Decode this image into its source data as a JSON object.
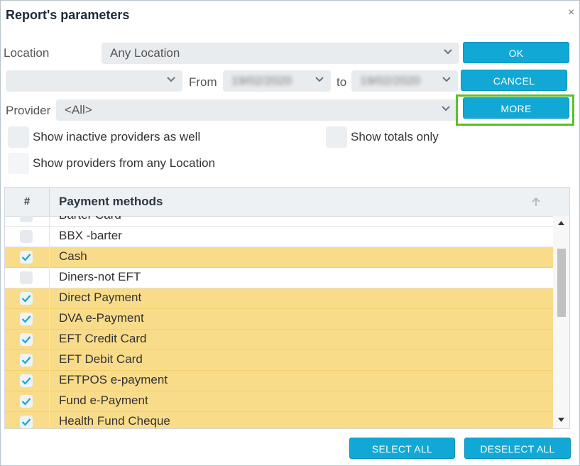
{
  "dialog": {
    "title": "Report's parameters",
    "close_glyph": "×"
  },
  "location": {
    "label": "Location",
    "value": "Any Location"
  },
  "period": {
    "value": "",
    "from_label": "From",
    "from_value": "19/02/2020",
    "to_label": "to",
    "to_value": "19/02/2020"
  },
  "provider": {
    "label": "Provider",
    "value": "<All>"
  },
  "buttons": {
    "ok": "OK",
    "cancel": "CANCEL",
    "more": "MORE",
    "select_all": "SELECT ALL",
    "deselect_all": "DESELECT ALL"
  },
  "options": {
    "inactive_providers": "Show inactive providers as well",
    "totals_only": "Show totals only",
    "any_location": "Show providers from any Location"
  },
  "grid": {
    "hash_header": "#",
    "title_header": "Payment methods",
    "rows": [
      {
        "label": "Barter Card",
        "checked": false
      },
      {
        "label": "BBX -barter",
        "checked": false
      },
      {
        "label": "Cash",
        "checked": true
      },
      {
        "label": "Diners-not EFT",
        "checked": false
      },
      {
        "label": "Direct Payment",
        "checked": true
      },
      {
        "label": "DVA e-Payment",
        "checked": true
      },
      {
        "label": "EFT Credit Card",
        "checked": true
      },
      {
        "label": "EFT Debit Card",
        "checked": true
      },
      {
        "label": "EFTPOS e-payment",
        "checked": true
      },
      {
        "label": "Fund e-Payment",
        "checked": true
      },
      {
        "label": "Health Fund Cheque",
        "checked": true
      }
    ]
  },
  "colors": {
    "accent": "#12a8d6",
    "selected_row": "#f9dc8a",
    "highlight": "#5cbf2a",
    "check": "#12a8d6"
  }
}
